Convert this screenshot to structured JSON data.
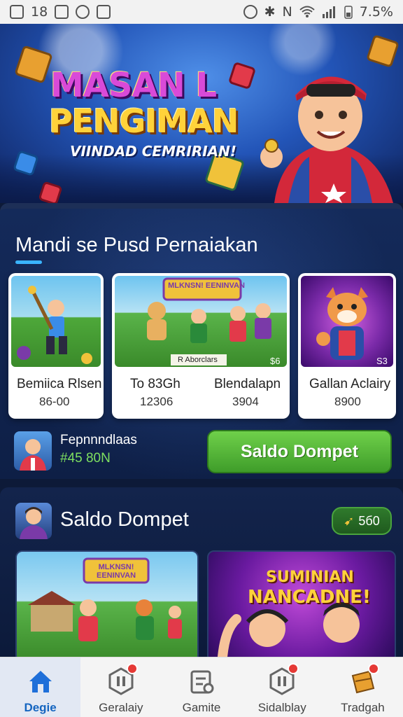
{
  "status_bar": {
    "left_text": "18",
    "right_text": "N",
    "battery": "7.5%"
  },
  "hero": {
    "title_line1": "MASAN L",
    "title_line2": "PENGIMAN",
    "subtitle": "VIINDAD CEMRIRIAN!"
  },
  "section1": {
    "title": "Mandi se Pusd Pernaiakan",
    "cards": [
      {
        "name": "Bemiica Rlsen",
        "value": "86-00"
      },
      {
        "name": "To 83Gh",
        "value": "12306",
        "name2": "Blendalapn",
        "value2": "3904",
        "banner": "MLKNSN! EENINVAN",
        "caption": "R Aborclars",
        "price": "$6"
      },
      {
        "name": "Gallan Aclairy",
        "value": "8900",
        "price": "S3"
      }
    ],
    "wallet": {
      "name": "Fepnnndlaas",
      "amount": "#45 80N"
    },
    "button_label": "Saldo Dompet"
  },
  "section2": {
    "title": "Saldo Dompet",
    "badge_value": "5б0",
    "promo1_banner": "MLKNSN! EENINVAN",
    "promo2_title_line1": "SUMINIAN",
    "promo2_title_line2": "NANCADNE!"
  },
  "nav": [
    {
      "label": "Degie",
      "icon": "home-icon",
      "active": true
    },
    {
      "label": "Geralaiy",
      "icon": "pause-shield-icon"
    },
    {
      "label": "Gamite",
      "icon": "ticket-icon"
    },
    {
      "label": "Sidalblay",
      "icon": "pause-shield-icon"
    },
    {
      "label": "Tradgah",
      "icon": "gift-icon"
    }
  ]
}
